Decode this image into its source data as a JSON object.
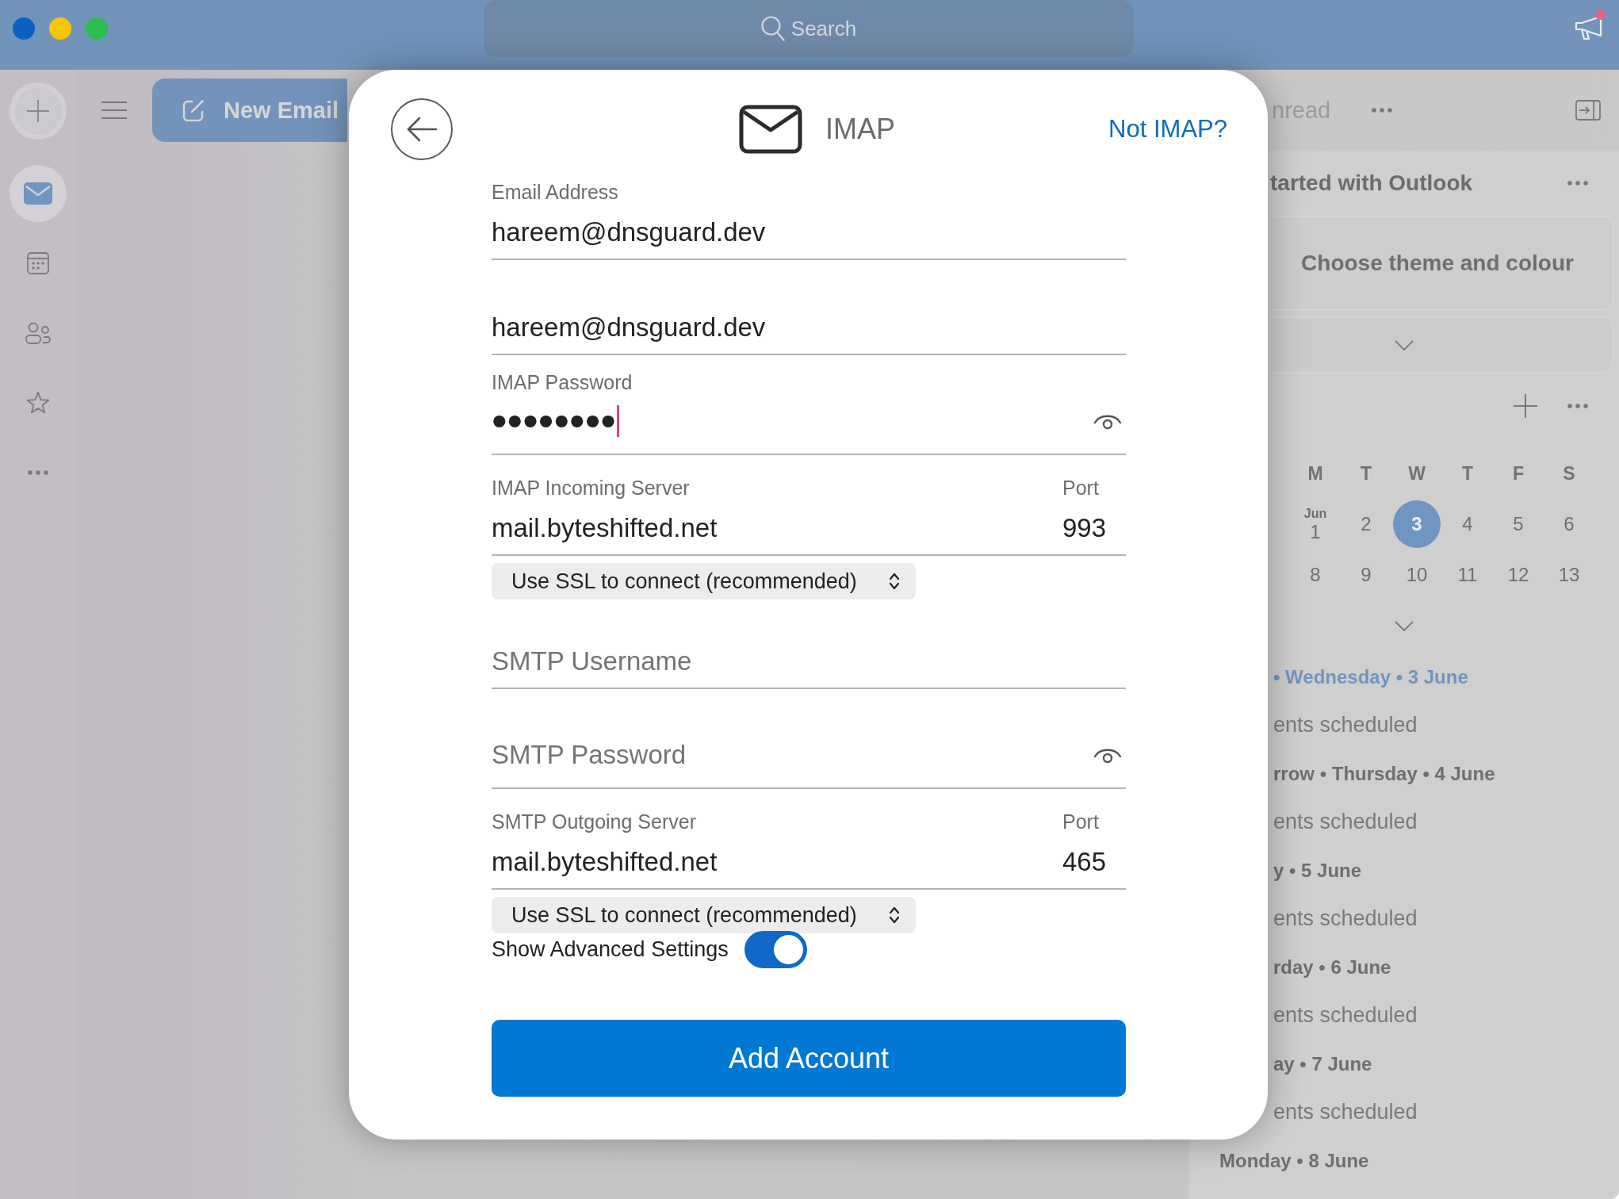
{
  "window": {
    "controls": [
      {
        "color": "#0a61c0"
      },
      {
        "color": "#f6c600"
      },
      {
        "color": "#2bbf4e"
      }
    ],
    "search": {
      "placeholder": "Search"
    },
    "feedback_badge": true
  },
  "rail": {
    "items": [
      {
        "selected": true
      },
      {
        "selected": false
      },
      {
        "selected": false
      },
      {
        "selected": false
      }
    ]
  },
  "toolbar": {
    "new_email_button": "New Email",
    "filter": "nread"
  },
  "dialog": {
    "title": "IMAP",
    "switch_link": "Not IMAP?",
    "fields": [
      {
        "kind": "text",
        "label": "Email Address",
        "value": "hareem@dnsguard.dev",
        "focused": false
      },
      {
        "kind": "text",
        "value": "hareem@dnsguard.dev",
        "focused": false
      },
      {
        "kind": "password",
        "label": "IMAP Password",
        "value": "••••••••",
        "focused": true
      },
      {
        "kind": "server",
        "label": "IMAP Incoming Server",
        "value": "mail.byteshifted.net",
        "port_label": "Port",
        "port": "993",
        "focused": false
      },
      {
        "kind": "select",
        "value": "Use SSL to connect (recommended)"
      },
      {
        "kind": "text",
        "placeholder": "SMTP Username",
        "focused": false
      },
      {
        "kind": "password",
        "placeholder": "SMTP Password",
        "focused": false
      },
      {
        "kind": "server",
        "label": "SMTP Outgoing Server",
        "value": "mail.byteshifted.net",
        "port_label": "Port",
        "port": "465",
        "focused": false
      },
      {
        "kind": "select",
        "value": "Use SSL to connect (recommended)"
      },
      {
        "kind": "toggle",
        "label": "Show Advanced Settings",
        "on": true
      }
    ],
    "submit": "Add Account"
  },
  "right_panel": {
    "section_title": "tarted with Outlook",
    "card": "Choose theme and colour",
    "calendar": {
      "weekdays": [
        "M",
        "T",
        "W",
        "T",
        "F",
        "S"
      ],
      "weeks": [
        [
          {
            "month": "Jun",
            "day": "1",
            "selected": false
          },
          {
            "day": "2",
            "selected": false
          },
          {
            "day": "3",
            "selected": true
          },
          {
            "day": "4",
            "selected": false
          },
          {
            "day": "5",
            "selected": false
          },
          {
            "day": "6",
            "selected": false
          }
        ],
        [
          {
            "day": "8",
            "selected": false
          },
          {
            "day": "9",
            "selected": false
          },
          {
            "day": "10",
            "selected": false
          },
          {
            "day": "11",
            "selected": false
          },
          {
            "day": "12",
            "selected": false
          },
          {
            "day": "13",
            "selected": false
          }
        ]
      ]
    },
    "agenda": [
      {
        "heading": "• Wednesday • 3 June",
        "today": true,
        "note": "ents scheduled"
      },
      {
        "heading": "rrow • Thursday • 4 June",
        "today": false,
        "note": "ents scheduled"
      },
      {
        "heading": "y • 5 June",
        "today": false,
        "note": "ents scheduled"
      },
      {
        "heading": "rday • 6 June",
        "today": false,
        "note": "ents scheduled"
      },
      {
        "heading": "ay • 7 June",
        "today": false,
        "note": "ents scheduled"
      },
      {
        "heading": "Monday • 8 June",
        "today": false
      }
    ]
  }
}
